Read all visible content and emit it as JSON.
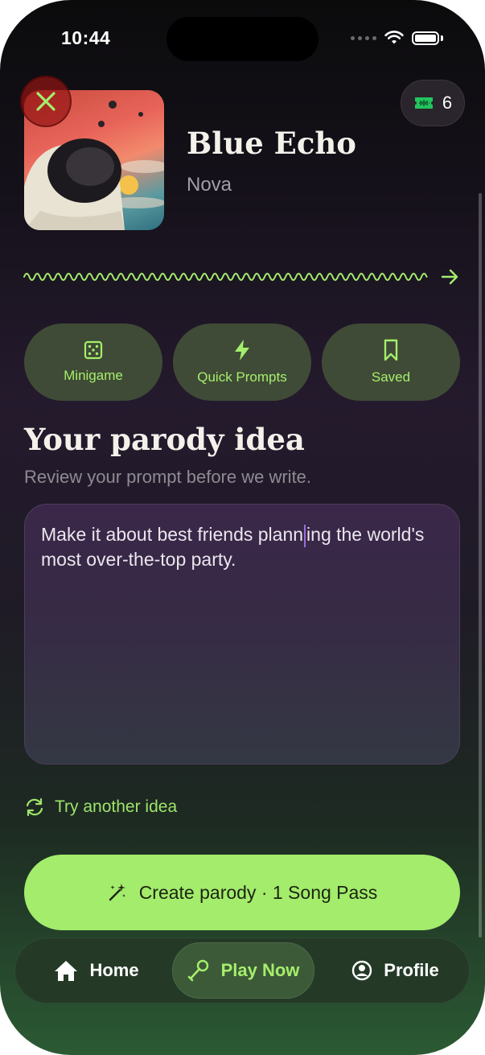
{
  "status_bar": {
    "time": "10:44"
  },
  "header": {
    "close_icon": "close-x-icon",
    "song_passes_count": "6",
    "song_title": "Blue Echo",
    "song_artist": "Nova"
  },
  "actions": [
    {
      "label": "Minigame",
      "icon": "dice-icon"
    },
    {
      "label": "Quick Prompts",
      "icon": "bolt-icon"
    },
    {
      "label": "Saved",
      "icon": "bookmark-icon"
    }
  ],
  "main": {
    "heading": "Your parody idea",
    "subheading": "Review your prompt before we write.",
    "prompt_before_caret": "Make it about best friends plann",
    "prompt_after_caret": "ing the world's most over-the-top party.",
    "try_another_label": "Try another idea",
    "create_button_label": "Create parody · 1 Song Pass"
  },
  "tabbar": {
    "items": [
      {
        "label": "Home",
        "icon": "home-icon"
      },
      {
        "label": "Play Now",
        "icon": "microphone-icon",
        "active": true
      },
      {
        "label": "Profile",
        "icon": "profile-icon"
      }
    ]
  },
  "colors": {
    "accent_green": "#a3ec6c",
    "close_red": "#96141a",
    "pill_bg": "#3f4b36"
  }
}
